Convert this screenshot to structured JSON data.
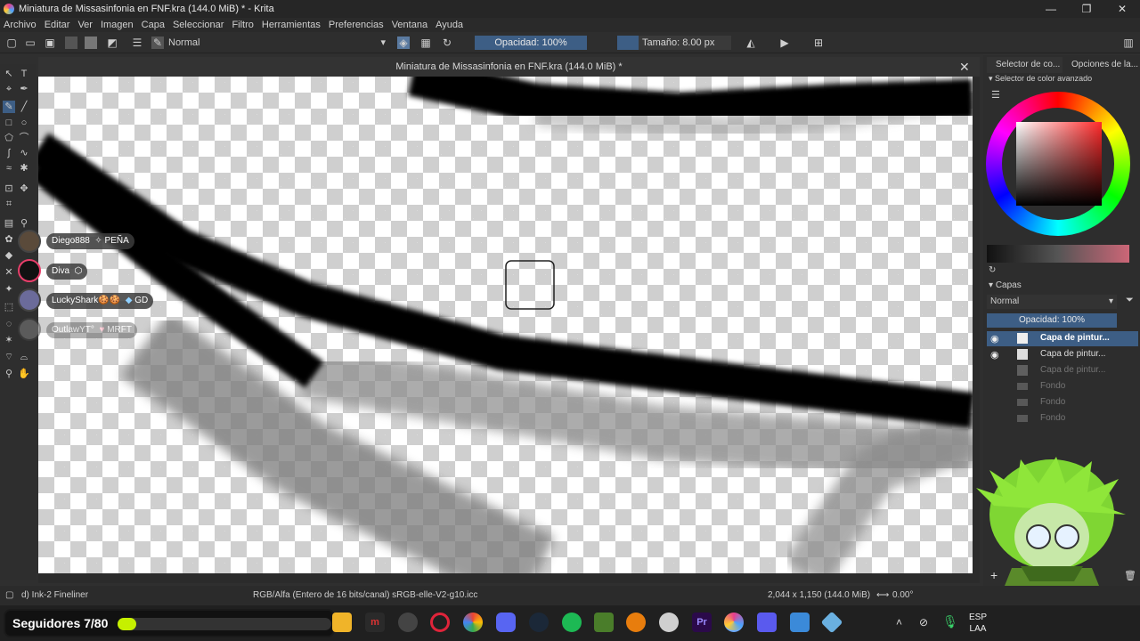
{
  "window": {
    "title": "Miniatura de Missasinfonia en FNF.kra (144.0 MiB) * - Krita"
  },
  "menu": [
    "Archivo",
    "Editar",
    "Ver",
    "Imagen",
    "Capa",
    "Seleccionar",
    "Filtro",
    "Herramientas",
    "Preferencias",
    "Ventana",
    "Ayuda"
  ],
  "toolbar": {
    "blend_mode": "Normal",
    "opacity": "Opacidad: 100%",
    "size": "Tamaño: 8.00 px"
  },
  "canvas": {
    "tab_title": "Miniatura de Missasinfonia en FNF.kra (144.0 MiB) *"
  },
  "right_panel": {
    "tabs": [
      "Selector de co...",
      "Opciones de la..."
    ],
    "color_selector_title": "Selector de color avanzado",
    "layers_title": "Capas",
    "layers_blend": "Normal",
    "layers_opacity": "Opacidad:  100%",
    "layers": [
      {
        "name": "Capa de pintur...",
        "active": true
      },
      {
        "name": "Capa de pintur...",
        "active": false
      },
      {
        "name": "Capa de pintur...",
        "active": false
      },
      {
        "name": "Fondo",
        "active": false
      },
      {
        "name": "Fondo",
        "active": false
      },
      {
        "name": "Fondo",
        "active": false
      }
    ]
  },
  "overlay": {
    "viewers": [
      {
        "name": "Diego888",
        "tag": "PEÑA"
      },
      {
        "name": "Diva",
        "tag": ""
      },
      {
        "name": "LuckyShark🍪🍪",
        "tag": "GD"
      },
      {
        "name": "OutlawYT°",
        "tag": "MRFT"
      }
    ],
    "followers": "Seguidores 7/80",
    "followers_fraction": 0.0875
  },
  "status": {
    "brush": "d) Ink-2 Fineliner",
    "color_space": "RGB/Alfa (Entero de 16 bits/canal)  sRGB-elle-V2-g10.icc",
    "dimensions": "2,044 x 1,150 (144.0 MiB)",
    "rotation": "0.00°"
  },
  "taskbar": {
    "lang": "ESP",
    "region": "LAA"
  },
  "colors": {
    "accent": "#3d5e85",
    "panel": "#2d2d2d",
    "follower_bar": "#c6f000"
  }
}
